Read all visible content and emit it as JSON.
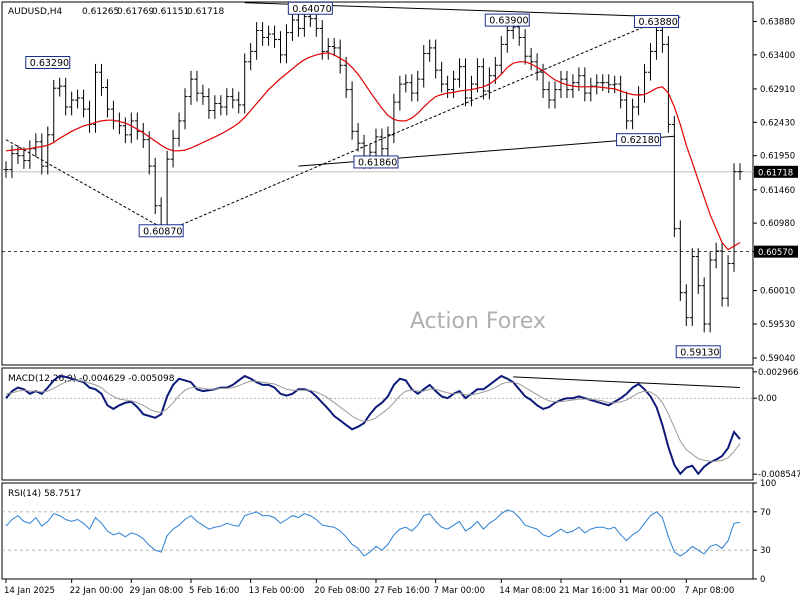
{
  "chart_data": [
    {
      "type": "candlestick",
      "panel": "price",
      "title": "AUDUSD,H4",
      "ohlc_text": [
        "0.61265",
        "0.61769",
        "0.61151",
        "0.61718"
      ],
      "watermark": "Action Forex",
      "ylim": [
        0.5894,
        0.6416
      ],
      "yticks": [
        "0.63880",
        "0.63400",
        "0.62910",
        "0.62430",
        "0.61950",
        "0.61460",
        "0.60980",
        "0.60570",
        "0.60010",
        "0.59530",
        "0.59040"
      ],
      "current_price": "0.61718",
      "horizontal_level": "0.60570",
      "annotations": [
        {
          "label": "0.63290",
          "x": 7,
          "y": 0.6329
        },
        {
          "label": "0.64070",
          "x": 51,
          "y": 0.6407
        },
        {
          "label": "0.63900",
          "x": 84,
          "y": 0.639
        },
        {
          "label": "0.63880",
          "x": 109,
          "y": 0.6388
        },
        {
          "label": "0.62180",
          "x": 106,
          "y": 0.6218
        },
        {
          "label": "0.61860",
          "x": 62,
          "y": 0.6186
        },
        {
          "label": "0.60870",
          "x": 26,
          "y": 0.6087
        },
        {
          "label": "0.59130",
          "x": 116,
          "y": 0.5913
        }
      ],
      "trendlines": [
        {
          "style": "solid",
          "from": [
            40,
            0.6415
          ],
          "to": [
            113,
            0.6394
          ]
        },
        {
          "style": "solid",
          "from": [
            49,
            0.618
          ],
          "to": [
            112,
            0.6223
          ]
        },
        {
          "style": "dashed",
          "from": [
            27,
            0.6087
          ],
          "to": [
            109,
            0.6388
          ]
        },
        {
          "style": "dashed",
          "from": [
            0,
            0.6218
          ],
          "to": [
            27,
            0.6087
          ]
        }
      ],
      "x_labels": [
        {
          "label": "14 Jan 2025",
          "x": 0
        },
        {
          "label": "22 Jan 00:00",
          "x": 11
        },
        {
          "label": "29 Jan 08:00",
          "x": 21
        },
        {
          "label": "5 Feb 16:00",
          "x": 31
        },
        {
          "label": "13 Feb 00:00",
          "x": 41
        },
        {
          "label": "20 Feb 08:00",
          "x": 52
        },
        {
          "label": "27 Feb 16:00",
          "x": 62
        },
        {
          "label": "7 Mar 00:00",
          "x": 72
        },
        {
          "label": "14 Mar 08:00",
          "x": 83
        },
        {
          "label": "21 Mar 16:00",
          "x": 93
        },
        {
          "label": "31 Mar 00:00",
          "x": 103
        },
        {
          "label": "7 Apr 08:00",
          "x": 114
        }
      ],
      "close_series": [
        0.6175,
        0.6198,
        0.6195,
        0.6188,
        0.6205,
        0.6215,
        0.618,
        0.6225,
        0.6292,
        0.6295,
        0.6265,
        0.6275,
        0.6278,
        0.6262,
        0.624,
        0.6315,
        0.6293,
        0.6262,
        0.6245,
        0.6238,
        0.6225,
        0.6245,
        0.623,
        0.6218,
        0.618,
        0.6123,
        0.609,
        0.619,
        0.622,
        0.6245,
        0.628,
        0.6305,
        0.6285,
        0.628,
        0.626,
        0.627,
        0.6265,
        0.628,
        0.6275,
        0.6268,
        0.633,
        0.6345,
        0.6375,
        0.6365,
        0.637,
        0.6362,
        0.634,
        0.6372,
        0.639,
        0.6378,
        0.6395,
        0.6392,
        0.6378,
        0.6345,
        0.6352,
        0.635,
        0.6325,
        0.629,
        0.623,
        0.6213,
        0.6188,
        0.62,
        0.6222,
        0.6205,
        0.6225,
        0.6272,
        0.6298,
        0.63,
        0.6285,
        0.6305,
        0.6342,
        0.635,
        0.6318,
        0.6298,
        0.629,
        0.6305,
        0.6323,
        0.6278,
        0.6298,
        0.6323,
        0.6288,
        0.631,
        0.6325,
        0.6355,
        0.6375,
        0.638,
        0.6365,
        0.6338,
        0.633,
        0.6315,
        0.629,
        0.6275,
        0.629,
        0.6305,
        0.629,
        0.63,
        0.631,
        0.6285,
        0.6295,
        0.63,
        0.63,
        0.6297,
        0.6298,
        0.6275,
        0.6245,
        0.6265,
        0.6283,
        0.6315,
        0.6345,
        0.6375,
        0.6355,
        0.624,
        0.609,
        0.5998,
        0.5962,
        0.605,
        0.6008,
        0.5953,
        0.6045,
        0.6058,
        0.599,
        0.604,
        0.6172,
        0.6172
      ],
      "ma_series": [
        0.6202,
        0.6203,
        0.6204,
        0.6204,
        0.6205,
        0.6207,
        0.6208,
        0.621,
        0.6214,
        0.622,
        0.6225,
        0.623,
        0.6234,
        0.6238,
        0.624,
        0.6243,
        0.6245,
        0.6246,
        0.6246,
        0.6244,
        0.6242,
        0.6238,
        0.6233,
        0.6228,
        0.6222,
        0.6216,
        0.621,
        0.6205,
        0.6202,
        0.6202,
        0.6203,
        0.6206,
        0.621,
        0.6214,
        0.6218,
        0.6222,
        0.6226,
        0.6231,
        0.6236,
        0.6242,
        0.625,
        0.626,
        0.627,
        0.628,
        0.629,
        0.6298,
        0.6306,
        0.6313,
        0.632,
        0.6327,
        0.6333,
        0.6337,
        0.634,
        0.6342,
        0.6343,
        0.634,
        0.6335,
        0.633,
        0.6322,
        0.6312,
        0.63,
        0.6287,
        0.6275,
        0.6263,
        0.6253,
        0.6247,
        0.6245,
        0.6245,
        0.6249,
        0.6256,
        0.6265,
        0.6273,
        0.628,
        0.6283,
        0.6285,
        0.6286,
        0.6288,
        0.6289,
        0.629,
        0.6292,
        0.6294,
        0.6298,
        0.6304,
        0.6312,
        0.6322,
        0.6328,
        0.633,
        0.633,
        0.6327,
        0.6322,
        0.6317,
        0.631,
        0.6304,
        0.63,
        0.6297,
        0.6295,
        0.6294,
        0.6294,
        0.6294,
        0.6294,
        0.6293,
        0.6292,
        0.6291,
        0.6288,
        0.6285,
        0.6283,
        0.6282,
        0.6283,
        0.6287,
        0.6292,
        0.6294,
        0.6285,
        0.6265,
        0.624,
        0.621,
        0.6185,
        0.616,
        0.6135,
        0.611,
        0.609,
        0.607,
        0.606,
        0.6065,
        0.607
      ]
    },
    {
      "type": "line",
      "panel": "indicator",
      "title": "MACD(12,26,9) -0.004629 -0.005098",
      "ylim": [
        -0.0092,
        0.0034
      ],
      "yticks": [
        "0.002966",
        "0.00",
        "-0.008547"
      ],
      "series": [
        {
          "values": [
            0.0,
            0.0008,
            0.0012,
            0.001,
            0.0005,
            0.0008,
            0.0005,
            0.0012,
            0.002,
            0.0025,
            0.0024,
            0.0022,
            0.002,
            0.0018,
            0.0012,
            0.001,
            0.0005,
            -0.0008,
            -0.0012,
            -0.0008,
            -0.0005,
            -0.0004,
            -0.001,
            -0.0018,
            -0.002,
            -0.0022,
            -0.0018,
            0.0002,
            0.0015,
            0.0022,
            0.002,
            0.0018,
            0.001,
            0.0008,
            0.0009,
            0.001,
            0.0012,
            0.0012,
            0.0015,
            0.002,
            0.0025,
            0.0022,
            0.0018,
            0.0015,
            0.0015,
            0.0012,
            0.0005,
            0.0003,
            0.0005,
            0.001,
            0.001,
            0.0008,
            0.0002,
            -0.0005,
            -0.0012,
            -0.002,
            -0.0025,
            -0.003,
            -0.0035,
            -0.0032,
            -0.0028,
            -0.0018,
            -0.001,
            -0.0005,
            0.0002,
            0.0015,
            0.0022,
            0.002,
            0.001,
            0.0005,
            0.001,
            0.0015,
            0.0008,
            0.0002,
            0.0,
            0.0005,
            0.0008,
            0.0,
            0.0005,
            0.001,
            0.001,
            0.0015,
            0.002,
            0.0025,
            0.0022,
            0.0018,
            0.001,
            0.0002,
            -0.0002,
            -0.0008,
            -0.0012,
            -0.001,
            -0.0005,
            -0.0002,
            0.0,
            0.0,
            0.0002,
            0.0,
            -0.0002,
            -0.0004,
            -0.0006,
            -0.0008,
            -0.0004,
            0.0,
            0.0005,
            0.0012,
            0.0016,
            0.001,
            0.0002,
            -0.001,
            -0.003,
            -0.0055,
            -0.0075,
            -0.0085,
            -0.0078,
            -0.0076,
            -0.0085,
            -0.0077,
            -0.0072,
            -0.0069,
            -0.0065,
            -0.0056,
            -0.0038,
            -0.0046
          ]
        },
        {
          "values": [
            0.0005,
            0.0006,
            0.0008,
            0.0009,
            0.0008,
            0.0008,
            0.0007,
            0.0008,
            0.0011,
            0.0015,
            0.0018,
            0.002,
            0.002,
            0.0019,
            0.0017,
            0.0015,
            0.0012,
            0.0006,
            0.0002,
            -0.0001,
            -0.0002,
            -0.0003,
            -0.0005,
            -0.0008,
            -0.0012,
            -0.0015,
            -0.0016,
            -0.0012,
            -0.0005,
            0.0003,
            0.0009,
            0.0012,
            0.0012,
            0.0011,
            0.001,
            0.001,
            0.0011,
            0.0011,
            0.0012,
            0.0014,
            0.0017,
            0.0019,
            0.0019,
            0.0018,
            0.0017,
            0.0016,
            0.0013,
            0.001,
            0.0009,
            0.0009,
            0.0009,
            0.0009,
            0.0007,
            0.0004,
            0.0,
            -0.0005,
            -0.001,
            -0.0015,
            -0.002,
            -0.0024,
            -0.0026,
            -0.0025,
            -0.0022,
            -0.0017,
            -0.0012,
            -0.0005,
            0.0003,
            0.0008,
            0.0009,
            0.0008,
            0.0008,
            0.001,
            0.001,
            0.0008,
            0.0006,
            0.0005,
            0.0006,
            0.0004,
            0.0004,
            0.0005,
            0.0007,
            0.0009,
            0.0012,
            0.0016,
            0.0018,
            0.0018,
            0.0016,
            0.0012,
            0.0008,
            0.0004,
            0.0,
            -0.0003,
            -0.0004,
            -0.0004,
            -0.0003,
            -0.0002,
            -0.0001,
            -0.0001,
            -0.0001,
            -0.0002,
            -0.0003,
            -0.0005,
            -0.0005,
            -0.0004,
            -0.0002,
            0.0002,
            0.0006,
            0.0008,
            0.0007,
            0.0003,
            -0.0005,
            -0.0018,
            -0.0033,
            -0.0048,
            -0.0058,
            -0.0063,
            -0.0068,
            -0.007,
            -0.0071,
            -0.0071,
            -0.007,
            -0.0067,
            -0.006,
            -0.0051
          ]
        }
      ],
      "trendlines": [
        {
          "style": "solid",
          "from": [
            85,
            0.0024
          ],
          "to": [
            123,
            0.0012
          ]
        }
      ]
    },
    {
      "type": "line",
      "panel": "indicator",
      "title": "RSI(14) 58.7517",
      "ylim": [
        0,
        100
      ],
      "yticks": [
        "100",
        "70",
        "30",
        "0"
      ],
      "levels": [
        70,
        30
      ],
      "series": [
        {
          "values": [
            55,
            62,
            66,
            60,
            58,
            64,
            55,
            60,
            68,
            66,
            62,
            60,
            62,
            58,
            52,
            64,
            58,
            50,
            46,
            48,
            44,
            48,
            46,
            42,
            35,
            30,
            28,
            45,
            52,
            56,
            62,
            66,
            60,
            56,
            52,
            54,
            55,
            58,
            56,
            55,
            66,
            68,
            70,
            66,
            66,
            64,
            58,
            62,
            66,
            64,
            68,
            66,
            62,
            56,
            55,
            54,
            50,
            44,
            36,
            32,
            24,
            28,
            34,
            30,
            36,
            46,
            52,
            54,
            50,
            56,
            66,
            68,
            60,
            54,
            52,
            56,
            60,
            50,
            54,
            60,
            52,
            58,
            62,
            68,
            72,
            70,
            64,
            56,
            54,
            52,
            46,
            44,
            48,
            52,
            48,
            50,
            54,
            48,
            52,
            54,
            54,
            52,
            54,
            46,
            40,
            46,
            50,
            58,
            66,
            70,
            64,
            44,
            28,
            24,
            28,
            34,
            30,
            26,
            34,
            36,
            32,
            40,
            58,
            59
          ]
        }
      ]
    }
  ]
}
